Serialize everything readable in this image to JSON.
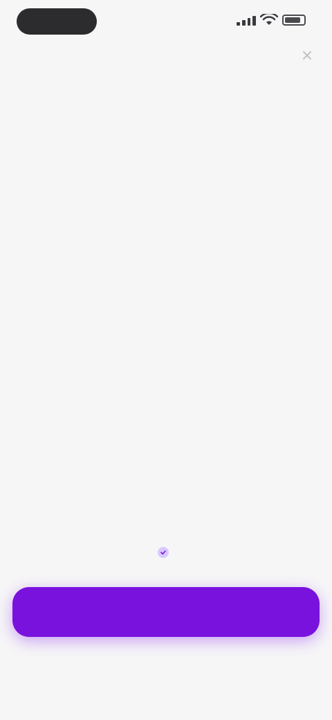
{
  "status_bar": {
    "icons": [
      "signal-icon",
      "wifi-icon",
      "battery-icon"
    ]
  },
  "close": {
    "icon": "close-icon"
  },
  "headline": {
    "accent_text": "",
    "main_text": ""
  },
  "subline": {
    "text": ""
  },
  "note": {
    "icon": "check-icon",
    "text": ""
  },
  "cta": {
    "label": ""
  },
  "footer": {
    "link_1": "",
    "link_2": "",
    "link_3": ""
  },
  "colors": {
    "background": "#f6f6f7",
    "accent": "#b56cf5",
    "cta": "#7a12de"
  }
}
